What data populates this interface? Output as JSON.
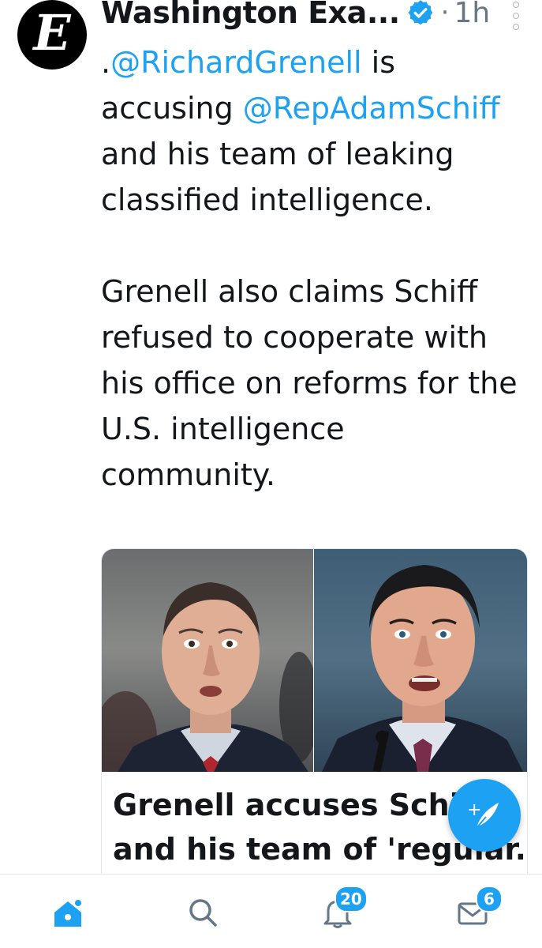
{
  "tweet": {
    "account_name": "Washington Exa...",
    "avatar_letter": "E",
    "separator": "·",
    "time": "1h",
    "text_segments": [
      ".",
      "@RichardGrenell",
      " is accusing ",
      "@RepAdamSchiff",
      " and his team of leaking classified intelligence."
    ],
    "paragraph_2": "Grenell also claims Schiff refused to cooperate with his office on reforms for the U.S. intelligence community."
  },
  "card": {
    "title_line_1": "Grenell accuses Schiff",
    "title_line_2": "and his team of 'regular..."
  },
  "fab": {
    "icon": "compose-tweet-icon",
    "plus": "+"
  },
  "nav": {
    "home_icon": "home-icon",
    "search_icon": "search-icon",
    "notifications_icon": "bell-icon",
    "notifications_count": "20",
    "messages_icon": "mail-icon",
    "messages_count": "6"
  },
  "colors": {
    "accent": "#1da1f2",
    "text": "#14171a",
    "muted": "#657786"
  }
}
